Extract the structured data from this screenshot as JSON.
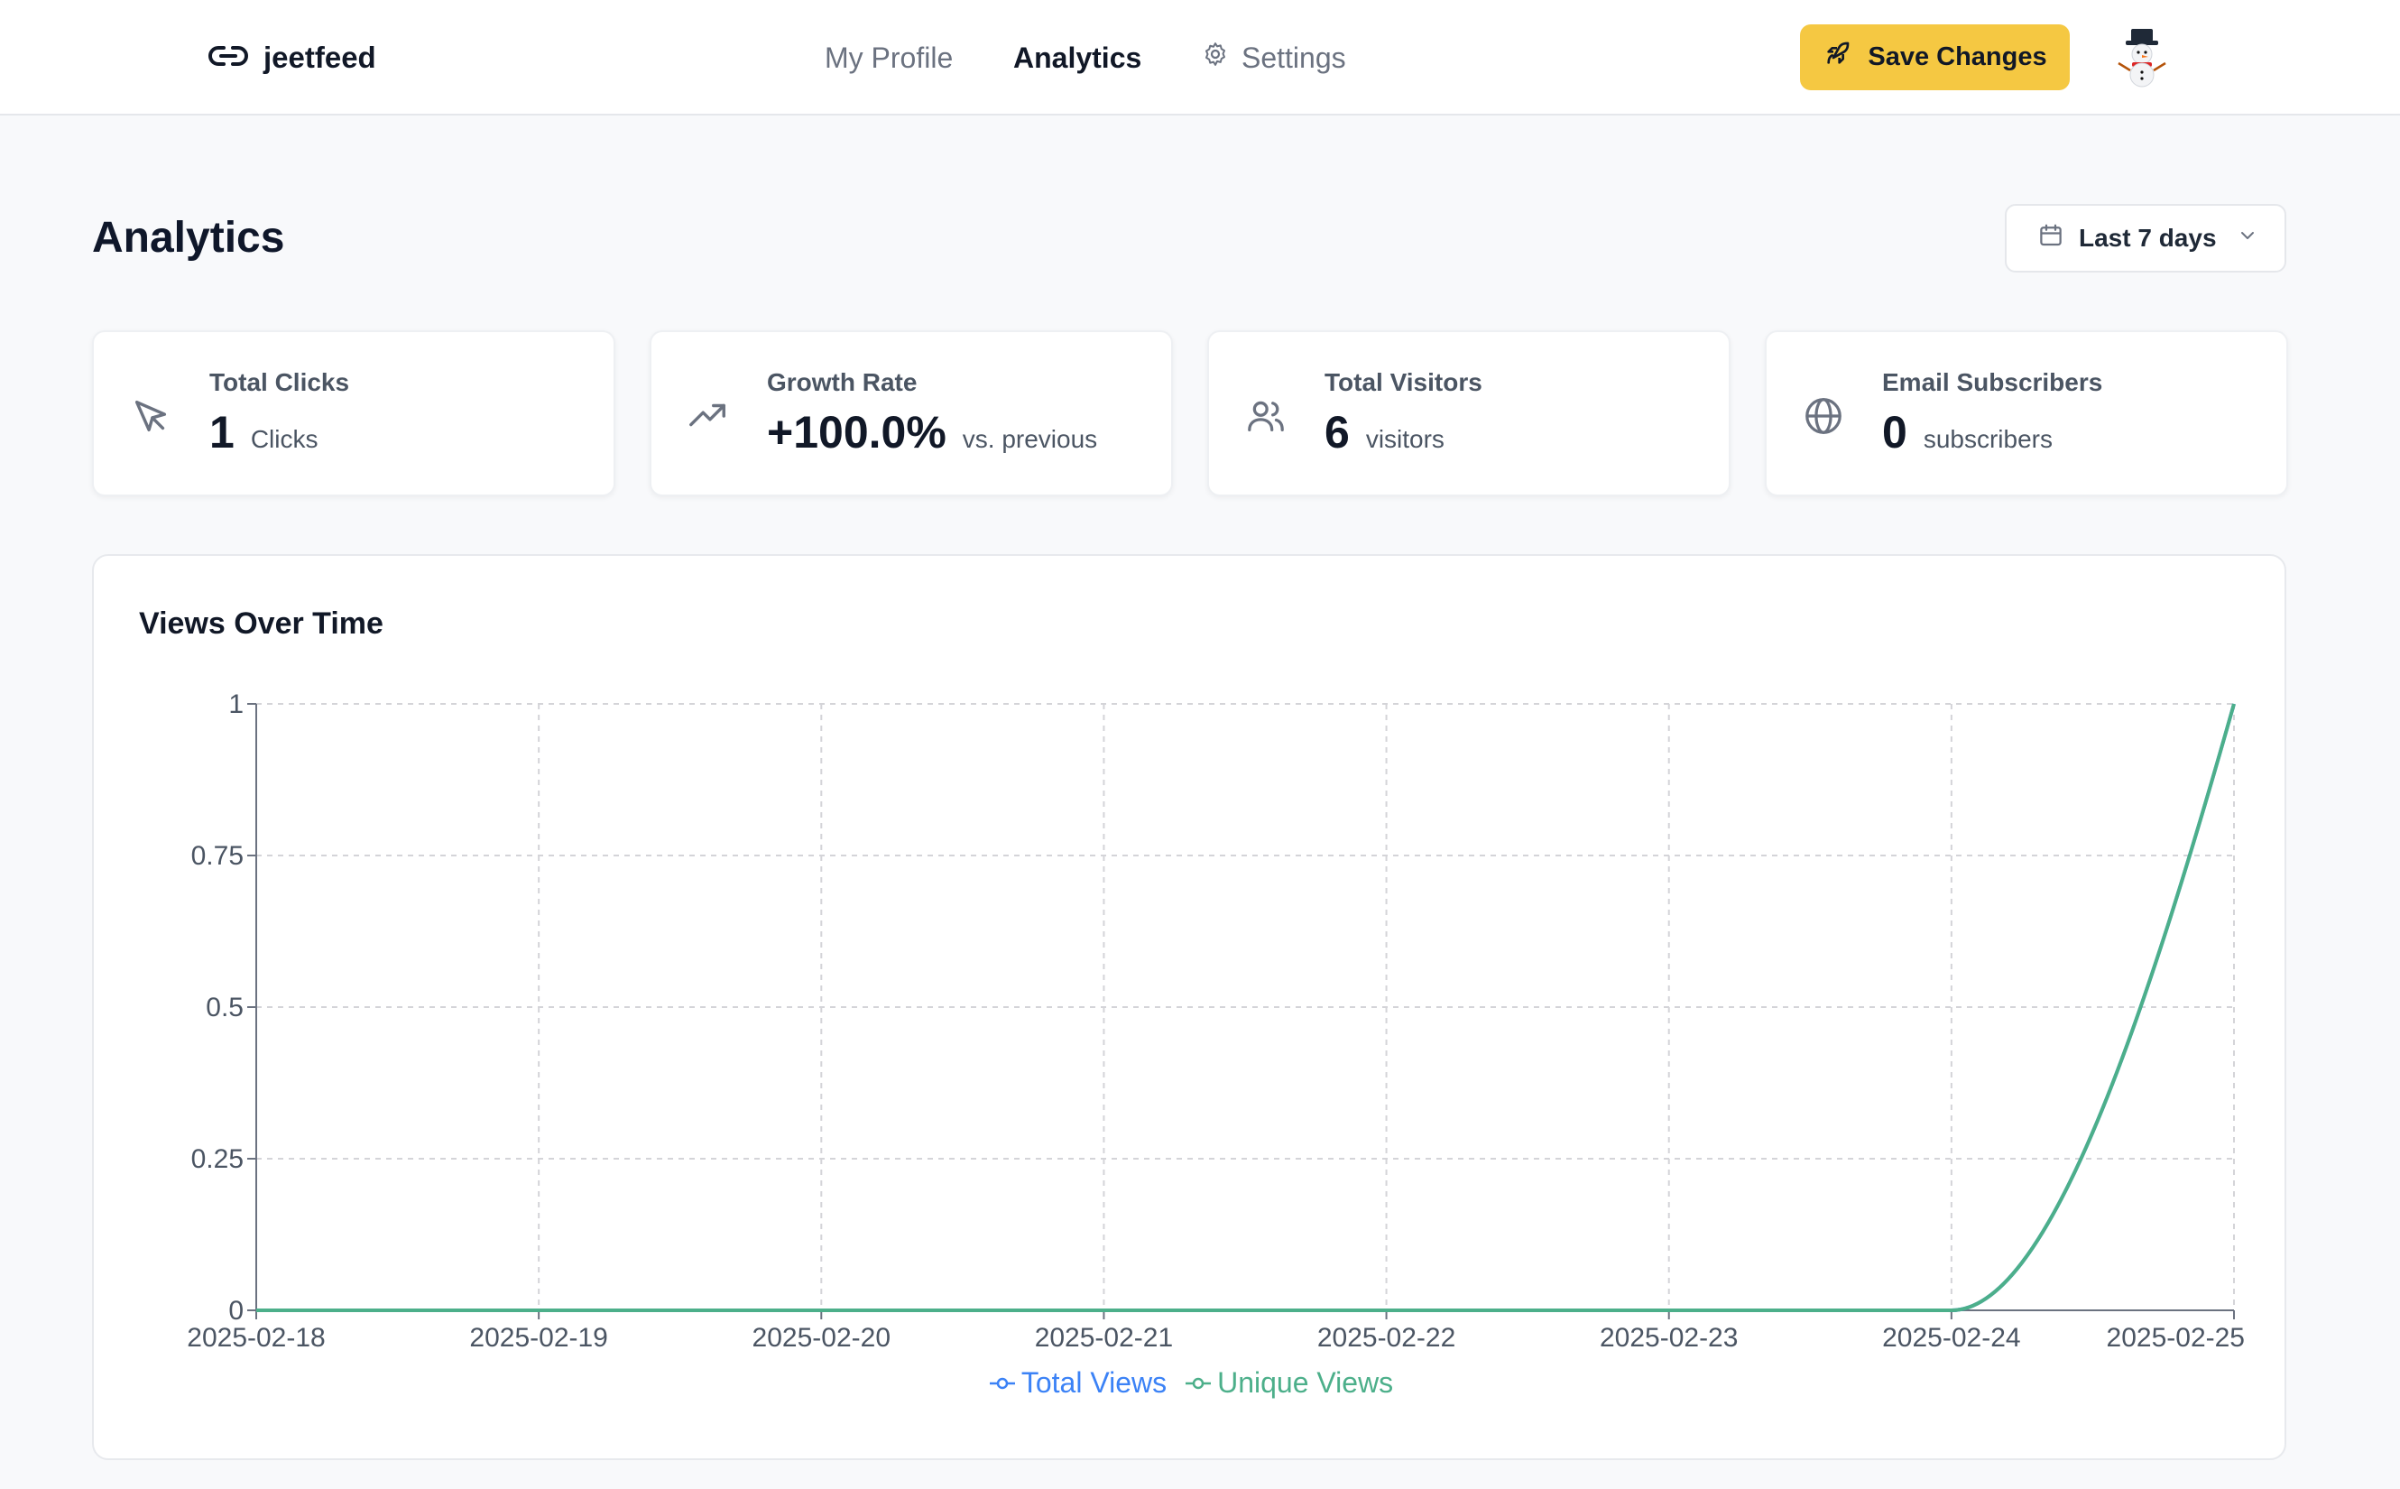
{
  "header": {
    "brand": "jeetfeed",
    "nav": {
      "profile": "My Profile",
      "analytics": "Analytics",
      "settings": "Settings"
    },
    "save_label": "Save Changes",
    "avatar_emoji": "⛄"
  },
  "page": {
    "title": "Analytics",
    "range": "Last 7 days"
  },
  "stats": [
    {
      "label": "Total Clicks",
      "value": "1",
      "unit": "Clicks",
      "icon": "cursor-icon"
    },
    {
      "label": "Growth Rate",
      "value": "+100.0%",
      "unit": "vs. previous",
      "icon": "trending-up-icon"
    },
    {
      "label": "Total Visitors",
      "value": "6",
      "unit": "visitors",
      "icon": "users-icon"
    },
    {
      "label": "Email Subscribers",
      "value": "0",
      "unit": "subscribers",
      "icon": "globe-icon"
    }
  ],
  "colors": {
    "accent": "#f5c842",
    "total_views": "#3b82f6",
    "unique_views": "#4caf8a"
  },
  "chart_data": {
    "type": "line",
    "title": "Views Over Time",
    "x": [
      "2025-02-18",
      "2025-02-19",
      "2025-02-20",
      "2025-02-21",
      "2025-02-22",
      "2025-02-23",
      "2025-02-24",
      "2025-02-25"
    ],
    "series": [
      {
        "name": "Total Views",
        "values": [
          0,
          0,
          0,
          0,
          0,
          0,
          0,
          1
        ]
      },
      {
        "name": "Unique Views",
        "values": [
          0,
          0,
          0,
          0,
          0,
          0,
          0,
          1
        ]
      }
    ],
    "yticks": [
      "0",
      "0.25",
      "0.5",
      "0.75",
      "1"
    ],
    "ylim": [
      0,
      1
    ],
    "grid": true,
    "legend": "bottom"
  }
}
